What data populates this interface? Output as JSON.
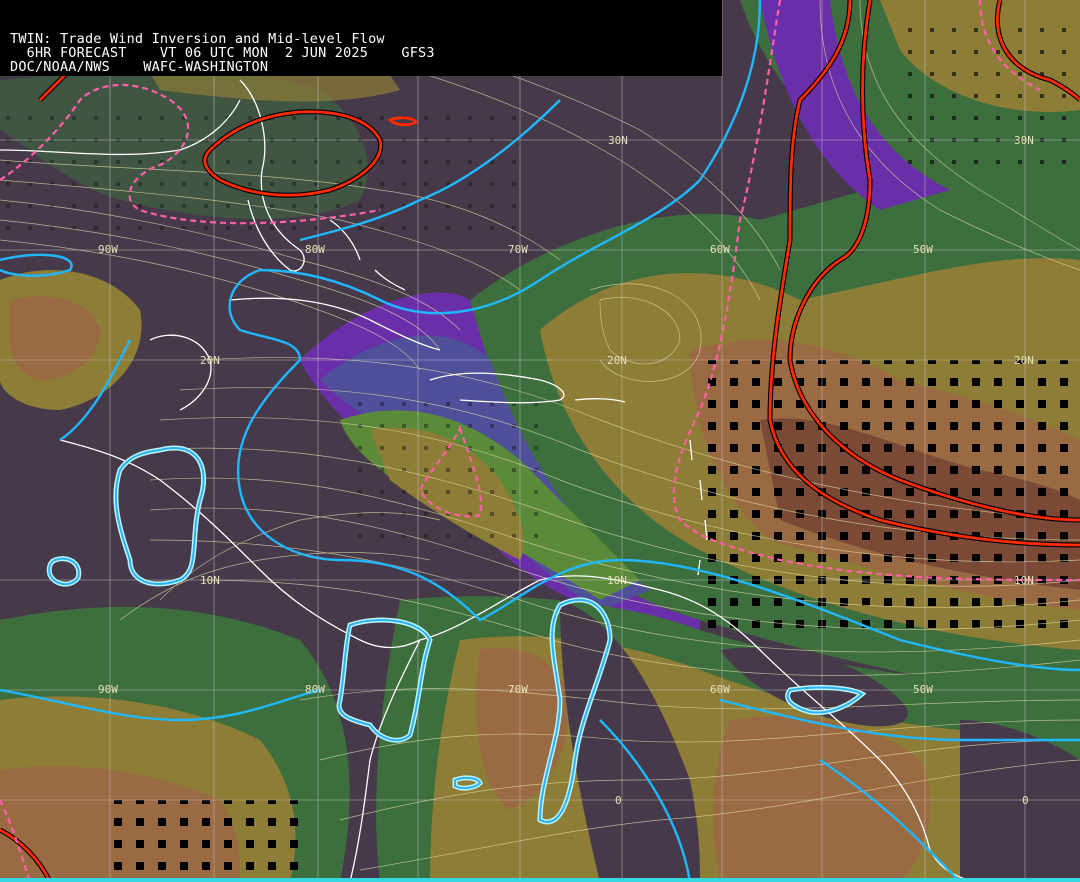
{
  "header": {
    "line1": "TWIN: Trade Wind Inversion and Mid-level Flow",
    "line2": "  6HR FORECAST    VT 06 UTC MON  2 JUN 2025    GFS3",
    "line3": "DOC/NOAA/NWS    WAFC-WASHINGTON"
  },
  "grid_labels": {
    "lat_30n_a": "30N",
    "lat_30n_b": "30N",
    "lat_20n_a": "20N",
    "lat_20n_b": "20N",
    "lat_20n_c": "20N",
    "lat_10n_a": "10N",
    "lat_10n_b": "10N",
    "lat_10n_c": "10N",
    "lat_0_a": "0",
    "lat_0_b": "0",
    "lon_90w_a": "90W",
    "lon_80w_a": "80W",
    "lon_70w_a": "70W",
    "lon_60w_a": "60W",
    "lon_50w_a": "50W",
    "lon_90w_b": "90W",
    "lon_80w_b": "80W",
    "lon_70w_b": "70W",
    "lon_60w_b": "60W",
    "lon_50w_b": "50W"
  },
  "colors": {
    "background_dark": "#463a4a",
    "purple": "#6a2fa8",
    "blue_purple": "#4f4f9a",
    "green_dark": "#3c6e3e",
    "green": "#5b8a3a",
    "olive": "#8d7d36",
    "tan": "#9a6a42",
    "brown": "#7a4a36",
    "cyan_contour": "#1fb8ff",
    "red_contour": "#ff2a00",
    "pink_dashed": "#ff5fa8",
    "streamline": "#e0d9a6",
    "coastline": "#ffffff"
  }
}
